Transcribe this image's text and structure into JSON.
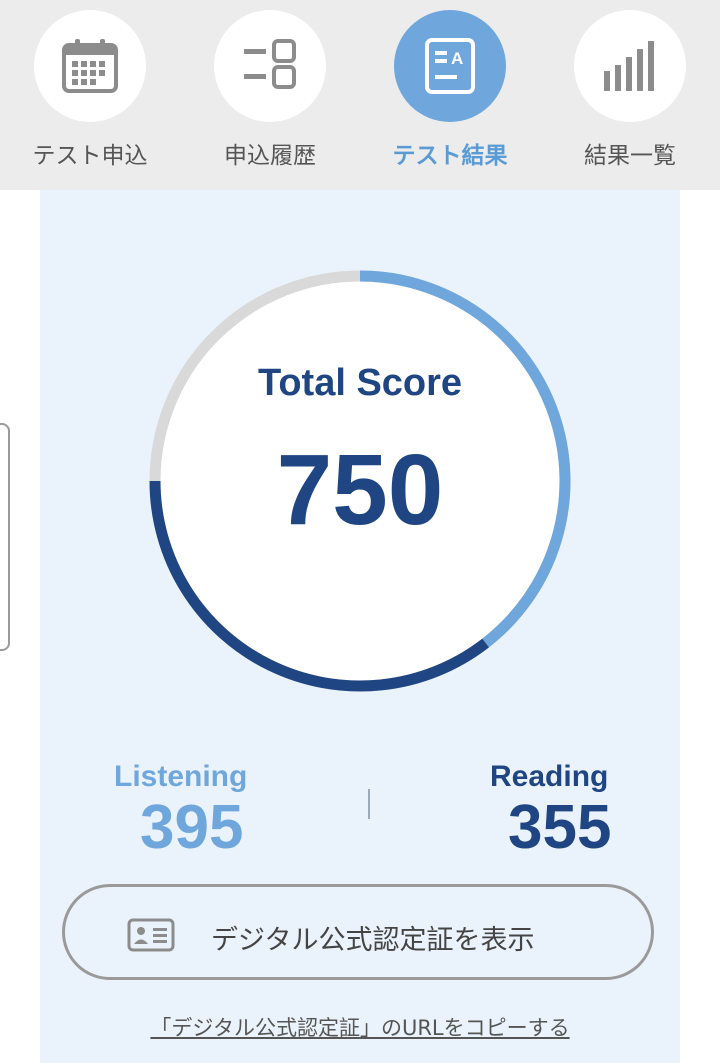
{
  "nav": {
    "items": [
      {
        "label": "テスト申込",
        "icon": "calendar-icon",
        "active": false
      },
      {
        "label": "申込履歴",
        "icon": "history-list-icon",
        "active": false
      },
      {
        "label": "テスト結果",
        "icon": "test-result-icon",
        "active": true
      },
      {
        "label": "結果一覧",
        "icon": "bar-chart-icon",
        "active": false
      }
    ]
  },
  "score": {
    "title": "Total Score",
    "total": "750",
    "listening_label": "Listening",
    "listening_value": "395",
    "reading_label": "Reading",
    "reading_value": "355",
    "gauge_fraction_total": 0.75,
    "gauge_fraction_listening": 0.395,
    "gauge_fraction_reading": 0.355
  },
  "actions": {
    "cert_button_label": "デジタル公式認定証を表示",
    "copy_link_label": "「デジタル公式認定証」のURLをコピーする"
  },
  "colors": {
    "listening": "#6fa6dc",
    "reading": "#1f4682",
    "track": "#d9d9d9",
    "panel": "#eaf3fb",
    "active_tab": "#6fa6dc"
  }
}
